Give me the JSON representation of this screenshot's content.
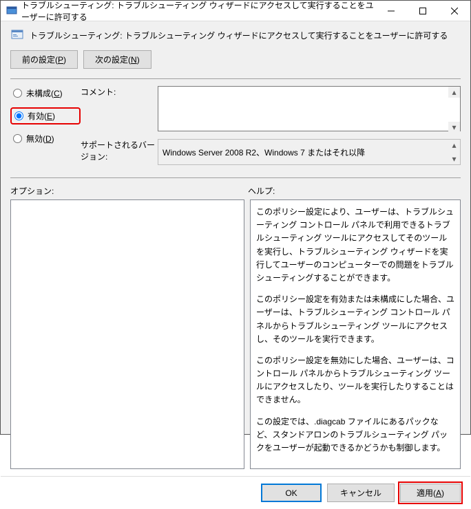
{
  "window": {
    "title": "トラブルシューティング: トラブルシューティング ウィザードにアクセスして実行することをユーザーに許可する"
  },
  "header": {
    "title": "トラブルシューティング: トラブルシューティング ウィザードにアクセスして実行することをユーザーに許可する"
  },
  "nav": {
    "prev": "前の設定(P)",
    "next": "次の設定(N)"
  },
  "radios": {
    "not_configured": "未構成(C)",
    "enabled": "有効(E)",
    "disabled": "無効(D)",
    "selected": "enabled"
  },
  "fields": {
    "comment_label": "コメント:",
    "comment_value": "",
    "supported_label": "サポートされるバージョン:",
    "supported_value": "Windows Server 2008 R2、Windows 7 またはそれ以降"
  },
  "sections": {
    "options_label": "オプション:",
    "help_label": "ヘルプ:"
  },
  "help": {
    "p1": "このポリシー設定により、ユーザーは、トラブルシューティング コントロール パネルで利用できるトラブルシューティング ツールにアクセスしてそのツールを実行し、トラブルシューティング ウィザードを実行してユーザーのコンピューターでの問題をトラブルシューティングすることができます。",
    "p2": "このポリシー設定を有効または未構成にした場合、ユーザーは、トラブルシューティング コントロール パネルからトラブルシューティング ツールにアクセスし、そのツールを実行できます。",
    "p3": "このポリシー設定を無効にした場合、ユーザーは、コントロール パネルからトラブルシューティング ツールにアクセスしたり、ツールを実行したりすることはできません。",
    "p4": "この設定では、.diagcab ファイルにあるパックなど、スタンドアロンのトラブルシューティング パックをユーザーが起動できるかどうかも制御します。"
  },
  "footer": {
    "ok": "OK",
    "cancel": "キャンセル",
    "apply": "適用(A)"
  }
}
